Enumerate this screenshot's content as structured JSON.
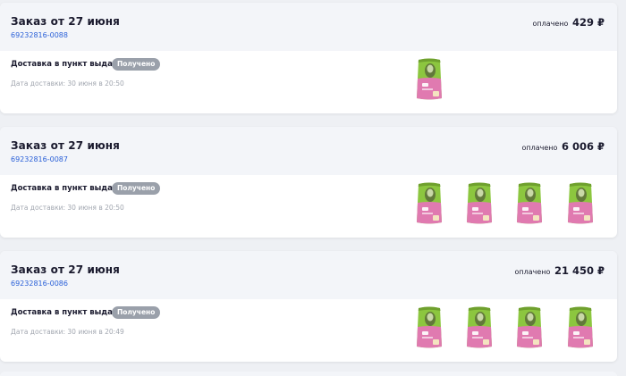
{
  "orders": [
    {
      "title": "Заказ от 27 июня",
      "number": "69232816-0088",
      "paid_label": "оплачено",
      "paid_amount": "429 ₽",
      "delivery": "Доставка в пункт выдачи",
      "status": "Получено",
      "date_text": "Дата доставки: 30 июня в 20:50",
      "product_count": 1
    },
    {
      "title": "Заказ от 27 июня",
      "number": "69232816-0087",
      "paid_label": "оплачено",
      "paid_amount": "6 006 ₽",
      "delivery": "Доставка в пункт выдачи",
      "status": "Получено",
      "date_text": "Дата доставки: 30 июня в 20:50",
      "product_count": 4
    },
    {
      "title": "Заказ от 27 июня",
      "number": "69232816-0086",
      "paid_label": "оплачено",
      "paid_amount": "21 450 ₽",
      "delivery": "Доставка в пункт выдачи",
      "status": "Получено",
      "date_text": "Дата доставки: 30 июня в 20:49",
      "product_count": 4
    }
  ],
  "colors": {
    "link": "#2a60d8",
    "badge": "#9aa0aa",
    "header_bg": "#f3f5f9",
    "package_green": "#8cc63f",
    "package_pink": "#e07ab0"
  },
  "icons": {
    "product": "cat-food-package-icon"
  }
}
